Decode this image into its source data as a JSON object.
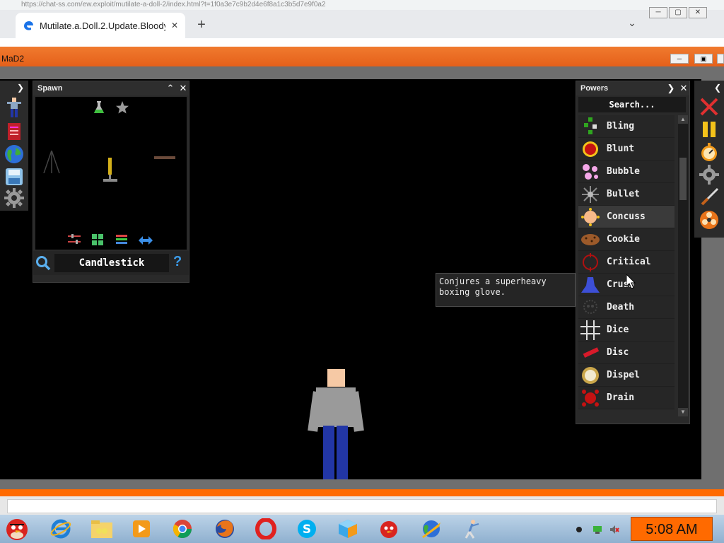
{
  "browser": {
    "url": "https://chat-ss.com/ew.exploit/mutilate-a-doll-2/index.html?t=1f0a3e7c9b2d4e6f8a1c3b5d7e9f0a2",
    "tab_title": "Mutilate.a.Doll.2.Update.Bloody.",
    "tab_close": "✕",
    "new_tab": "+",
    "dropdown": "⌄"
  },
  "game": {
    "title": "MaD2"
  },
  "spawn": {
    "header": "Spawn",
    "selected_item": "Candlestick",
    "help": "?"
  },
  "powers": {
    "header": "Powers",
    "search_placeholder": "Search...",
    "items": [
      {
        "label": "Bling",
        "icon": "bling-icon",
        "color": "#2fa51f"
      },
      {
        "label": "Blunt",
        "icon": "blunt-icon",
        "color": "#c41212"
      },
      {
        "label": "Bubble",
        "icon": "bubble-icon",
        "color": "#f4a7e8"
      },
      {
        "label": "Bullet",
        "icon": "bullet-icon",
        "color": "#8a8a8a"
      },
      {
        "label": "Concuss",
        "icon": "concuss-icon",
        "color": "#f7b98a"
      },
      {
        "label": "Cookie",
        "icon": "cookie-icon",
        "color": "#9c5a2a"
      },
      {
        "label": "Critical",
        "icon": "critical-icon",
        "color": "#b01010"
      },
      {
        "label": "Crush",
        "icon": "crush-icon",
        "color": "#3d4fd6"
      },
      {
        "label": "Death",
        "icon": "death-icon",
        "color": "#444444"
      },
      {
        "label": "Dice",
        "icon": "dice-icon",
        "color": "#dddddd"
      },
      {
        "label": "Disc",
        "icon": "disc-icon",
        "color": "#d81a2a"
      },
      {
        "label": "Dispel",
        "icon": "dispel-icon",
        "color": "#f2ead0"
      },
      {
        "label": "Drain",
        "icon": "drain-icon",
        "color": "#c41212"
      }
    ]
  },
  "tooltip": {
    "line1": "Conjures a superheavy",
    "line2": "boxing glove."
  },
  "taskbar": {
    "clock": "5:08 AM"
  }
}
